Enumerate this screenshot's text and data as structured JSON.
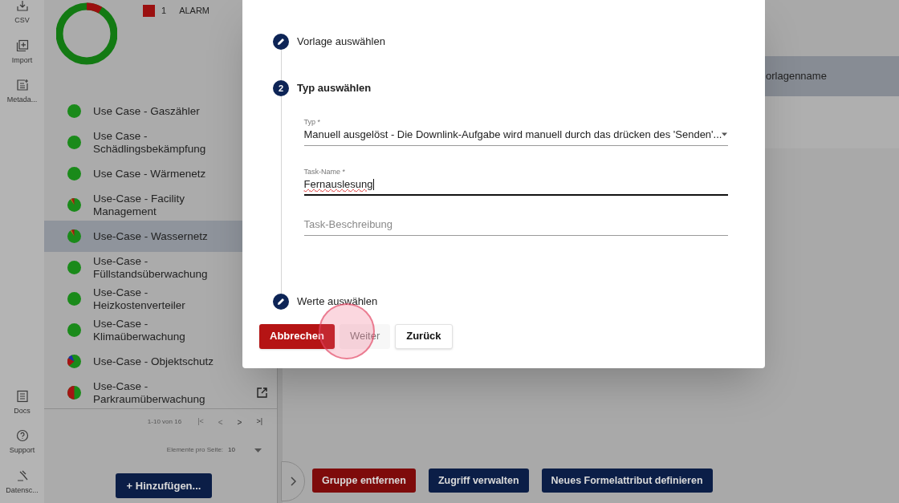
{
  "sidebar": {
    "top_items": [
      {
        "label": "CSV"
      },
      {
        "label": "Import"
      },
      {
        "label": "Metada..."
      }
    ],
    "bottom_items": [
      {
        "label": "Docs"
      },
      {
        "label": "Support"
      },
      {
        "label": "Datensc..."
      }
    ]
  },
  "status_legend": [
    {
      "count": "1",
      "label": "ALARM",
      "color": "#9b1010"
    }
  ],
  "use_cases": {
    "items": [
      {
        "label": "Use Case - Gaszähler",
        "kind": "ok",
        "selected": false
      },
      {
        "label": "Use Case - Schädlingsbekämpfung",
        "kind": "ok",
        "selected": false
      },
      {
        "label": "Use Case - Wärmenetz",
        "kind": "ok",
        "selected": false
      },
      {
        "label": "Use-Case - Facility Management",
        "kind": "minor",
        "selected": false
      },
      {
        "label": "Use-Case - Wassernetz",
        "kind": "minor",
        "selected": true
      },
      {
        "label": "Use-Case - Füllstandsüberwachung",
        "kind": "ok",
        "selected": false
      },
      {
        "label": "Use-Case - Heizkostenverteiler",
        "kind": "ok",
        "selected": false
      },
      {
        "label": "Use-Case - Klimaüberwachung",
        "kind": "ok",
        "selected": false
      },
      {
        "label": "Use-Case - Objektschutz",
        "kind": "mixed",
        "selected": false
      },
      {
        "label": "Use-Case - Parkraumüberwachung",
        "kind": "split",
        "selected": false,
        "hovered": true
      }
    ],
    "pagination": {
      "range": "1-10 von 16",
      "first": "|<",
      "prev": "<",
      "next": ">",
      "last": ">|",
      "page_size_label": "Elemente pro Seite:",
      "page_size": "10"
    },
    "add_button": "+ Hinzufügen..."
  },
  "table": {
    "columns": [
      "orlagenname"
    ]
  },
  "actions": [
    {
      "label": "Gruppe entfernen",
      "kind": "danger"
    },
    {
      "label": "Zugriff verwalten",
      "kind": "primary"
    },
    {
      "label": "Neues Formelattribut definieren",
      "kind": "primary"
    }
  ],
  "dialog": {
    "steps": [
      {
        "kind": "done",
        "label": "Vorlage auswählen"
      },
      {
        "kind": "active",
        "number": "2",
        "label": "Typ auswählen"
      },
      {
        "kind": "done",
        "label": "Werte auswählen"
      }
    ],
    "fields": [
      {
        "kind": "select",
        "label": "Typ *",
        "value": "Manuell ausgelöst - Die Downlink-Aufgabe wird manuell durch das drücken des 'Senden'...",
        "focused": false
      },
      {
        "kind": "text",
        "label": "Task-Name *",
        "value": "Fernauslesung",
        "focused": true
      },
      {
        "kind": "text",
        "placeholder": "Task-Beschreibung",
        "focused": false
      }
    ],
    "buttons": [
      {
        "label": "Abbrechen",
        "kind": "danger",
        "disabled": false
      },
      {
        "label": "Weiter",
        "kind": "plain",
        "disabled": true
      },
      {
        "label": "Zurück",
        "kind": "outlined",
        "disabled": false
      }
    ]
  }
}
